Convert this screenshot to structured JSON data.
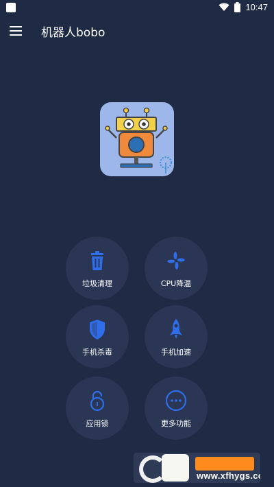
{
  "status_bar": {
    "time": "10:47",
    "icons": [
      "app-notification-icon",
      "wifi-icon",
      "battery-icon"
    ]
  },
  "app_bar": {
    "menu_icon": "hamburger-menu-icon",
    "title": "机器人bobo"
  },
  "logo": {
    "description_icon": "robot-logo-icon"
  },
  "features": [
    {
      "label": "垃圾清理",
      "icon": "trash-icon"
    },
    {
      "label": "CPU降温",
      "icon": "fan-icon"
    },
    {
      "label": "手机杀毒",
      "icon": "shield-icon"
    },
    {
      "label": "手机加速",
      "icon": "rocket-icon"
    },
    {
      "label": "应用锁",
      "icon": "lock-icon"
    },
    {
      "label": "更多功能",
      "icon": "more-icon"
    }
  ],
  "watermark": {
    "text": "www.xfhygs.com"
  },
  "colors": {
    "background": "#1f2a45",
    "button_bg": "#2a3654",
    "icon_blue": "#2f6ee8",
    "text": "#ffffff"
  }
}
